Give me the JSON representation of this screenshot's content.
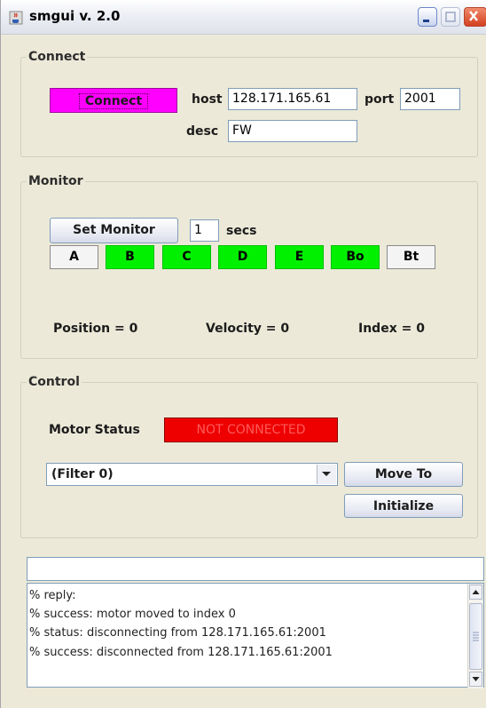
{
  "window": {
    "title": "smgui v. 2.0"
  },
  "connect": {
    "legend": "Connect",
    "button_label": "Connect",
    "host_label": "host",
    "host_value": "128.171.165.61",
    "port_label": "port",
    "port_value": "2001",
    "desc_label": "desc",
    "desc_value": "FW"
  },
  "monitor": {
    "legend": "Monitor",
    "set_button": "Set Monitor",
    "secs_value": "1",
    "secs_label": "secs",
    "indicators": [
      {
        "label": "A",
        "color": "#f4f4f4"
      },
      {
        "label": "B",
        "color": "#00f000"
      },
      {
        "label": "C",
        "color": "#00f000"
      },
      {
        "label": "D",
        "color": "#00f000"
      },
      {
        "label": "E",
        "color": "#00f000"
      },
      {
        "label": "Bo",
        "color": "#00f000"
      },
      {
        "label": "Bt",
        "color": "#f4f4f4"
      }
    ],
    "position": "Position = 0",
    "velocity": "Velocity = 0",
    "index": "Index = 0"
  },
  "control": {
    "legend": "Control",
    "motor_status_label": "Motor Status",
    "status_value": "NOT CONNECTED",
    "status_color": "#ee0000",
    "filter_selected": "(Filter 0)",
    "move_to_button": "Move To",
    "initialize_button": "Initialize"
  },
  "command_input": {
    "value": ""
  },
  "log": {
    "lines": [
      "% reply:",
      "% success: motor moved to index 0",
      "% status: disconnecting from 128.171.165.61:2001",
      "% success: disconnected from 128.171.165.61:2001"
    ]
  },
  "colors": {
    "connect_button": "#ff00ff",
    "ok": "#00f000",
    "error": "#ee0000"
  }
}
